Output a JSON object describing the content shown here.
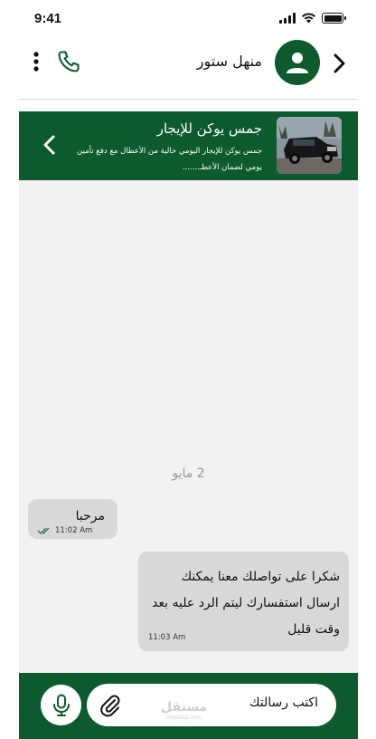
{
  "status_bar": {
    "time": "9:41",
    "icons": [
      "signal-icon",
      "wifi-icon",
      "battery-icon"
    ]
  },
  "header": {
    "contact_name": "منهل ستور",
    "icons": [
      "chevron-right-icon",
      "user-icon",
      "phone-icon",
      "more-vertical-icon"
    ]
  },
  "listing": {
    "title": "جمس يوكن للإيجار",
    "description": "جمس يوكن للإيجار اليومي خالية من الأعطال مع دفع تأمين يومي لضمان الأعطـ.......",
    "image_alt": "black-suv-photo"
  },
  "conversation": {
    "date_separator": "2 مايو",
    "messages": [
      {
        "text": "مرحبا",
        "time": "11:02 Am",
        "status": "read"
      },
      {
        "text": "شكرا على تواصلك معنا يمكنك ارسال استفسارك ليتم الرد عليه بعد وقت قليل",
        "time": "11:03 Am"
      }
    ]
  },
  "composer": {
    "placeholder": "اكتب رسالتك",
    "watermark": "مستقل",
    "watermark_sub": "mostaql.com"
  },
  "colors": {
    "brand_green": "#0c5a2e",
    "chat_background": "#f2f2f2",
    "bubble": "#d9d9d9"
  }
}
